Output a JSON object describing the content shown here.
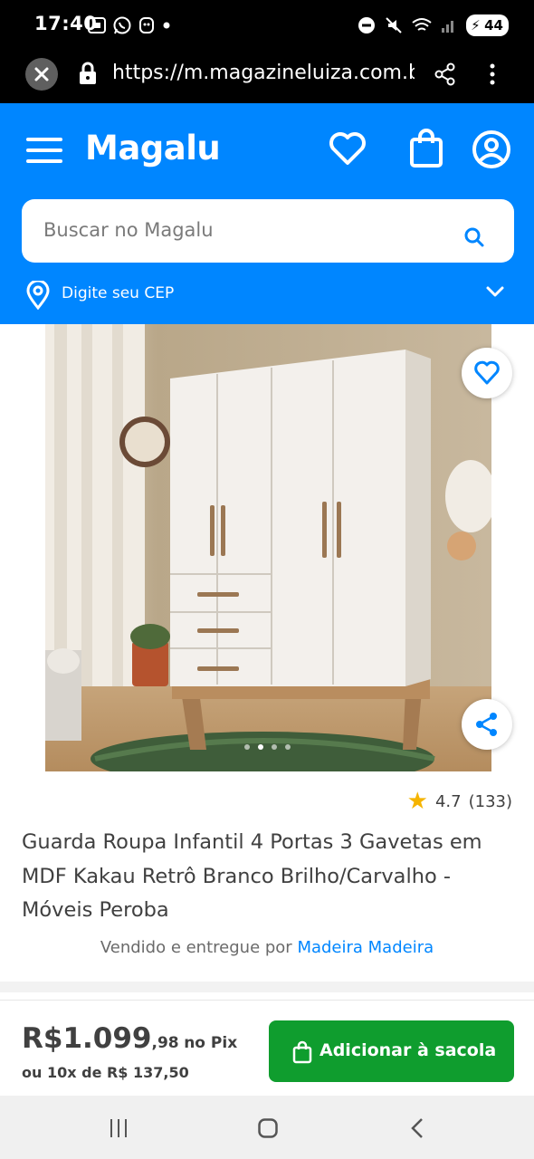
{
  "status_bar": {
    "time": "17:40",
    "battery": "44",
    "icons": [
      "screenshot-icon",
      "whatsapp-icon",
      "app-icon",
      "dot-icon",
      "dnd-icon",
      "mute-icon",
      "wifi-icon",
      "signal-icon",
      "battery-icon"
    ]
  },
  "browser": {
    "url": "https://m.magazineluiza.com.br/g",
    "icons": [
      "close-icon",
      "lock-icon",
      "share-icon",
      "menu-icon"
    ]
  },
  "header": {
    "logo": "Magalu",
    "icons": [
      "hamburger-icon",
      "heart-icon",
      "bag-icon",
      "account-icon"
    ],
    "search_placeholder": "Buscar no Magalu",
    "cep_text": "Digite seu CEP",
    "brand_color": "#0086ff"
  },
  "product": {
    "rating": "4.7",
    "rating_count": "(133)",
    "title": "Guarda Roupa Infantil 4 Portas 3 Gavetas em MDF Kakau Retrô Branco Brilho/Carvalho - Móveis Peroba",
    "seller_prefix": "Vendido e entregue por",
    "seller_name": "Madeira Madeira",
    "image_count": 4,
    "active_image": 1
  },
  "price": {
    "currency_int": "R$1.099",
    "cents": ",98",
    "pix_label": "no Pix",
    "installments": "ou 10x de R$ 137,50",
    "add_button": "Adicionar à sacola",
    "button_color": "#0f9d2e"
  },
  "nav": {
    "icons": [
      "recent-apps-icon",
      "home-icon",
      "back-icon"
    ]
  }
}
